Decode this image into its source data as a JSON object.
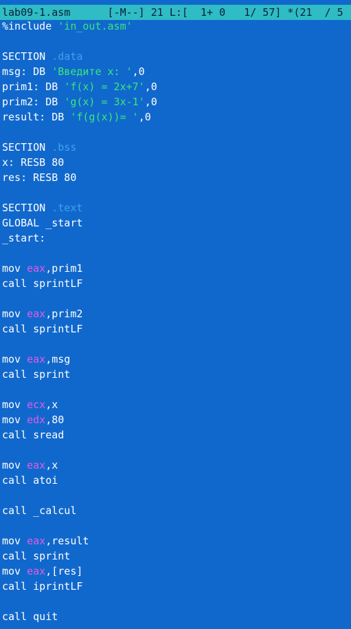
{
  "status": {
    "filename": "lab09-1.asm",
    "info": "      [-M--] 21 L:[  1+ 0   1/ 57] *(21  / 5"
  },
  "colors": {
    "background": "#1168cc",
    "status_bar": "#2fbcc4",
    "string": "#38e87a",
    "section_name": "#3fa2f0",
    "register": "#e05ce8",
    "text": "#ffffff"
  },
  "lines": [
    [
      {
        "t": "%include "
      },
      {
        "t": "'in_out.asm'",
        "c": "str"
      }
    ],
    [],
    [
      {
        "t": "SECTION "
      },
      {
        "t": ".data",
        "c": "sec"
      }
    ],
    [
      {
        "t": "msg: DB "
      },
      {
        "t": "'Введите x: '",
        "c": "str"
      },
      {
        "t": ",0"
      }
    ],
    [
      {
        "t": "prim1: DB "
      },
      {
        "t": "'f(x) = 2x+7'",
        "c": "str"
      },
      {
        "t": ",0"
      }
    ],
    [
      {
        "t": "prim2: DB "
      },
      {
        "t": "'g(x) = 3x-1'",
        "c": "str"
      },
      {
        "t": ",0"
      }
    ],
    [
      {
        "t": "result: DB "
      },
      {
        "t": "'f(g(x))= '",
        "c": "str"
      },
      {
        "t": ",0"
      }
    ],
    [],
    [
      {
        "t": "SECTION "
      },
      {
        "t": ".bss",
        "c": "sec"
      }
    ],
    [
      {
        "t": "x: RESB 80"
      }
    ],
    [
      {
        "t": "res: RESB 80"
      }
    ],
    [],
    [
      {
        "t": "SECTION "
      },
      {
        "t": ".text",
        "c": "sec"
      }
    ],
    [
      {
        "t": "GLOBAL _start"
      }
    ],
    [
      {
        "t": "_start:"
      }
    ],
    [],
    [
      {
        "t": "mov "
      },
      {
        "t": "eax",
        "c": "reg"
      },
      {
        "t": ",prim1"
      }
    ],
    [
      {
        "t": "call sprintLF"
      }
    ],
    [],
    [
      {
        "t": "mov "
      },
      {
        "t": "eax",
        "c": "reg"
      },
      {
        "t": ",prim2"
      }
    ],
    [
      {
        "t": "call sprintLF"
      }
    ],
    [],
    [
      {
        "t": "mov "
      },
      {
        "t": "eax",
        "c": "reg"
      },
      {
        "t": ",msg"
      }
    ],
    [
      {
        "t": "call sprint"
      }
    ],
    [],
    [
      {
        "t": "mov "
      },
      {
        "t": "ecx",
        "c": "reg"
      },
      {
        "t": ",x"
      }
    ],
    [
      {
        "t": "mov "
      },
      {
        "t": "edx",
        "c": "reg"
      },
      {
        "t": ",80"
      }
    ],
    [
      {
        "t": "call sread"
      }
    ],
    [],
    [
      {
        "t": "mov "
      },
      {
        "t": "eax",
        "c": "reg"
      },
      {
        "t": ",x"
      }
    ],
    [
      {
        "t": "call atoi"
      }
    ],
    [],
    [
      {
        "t": "call _calcul"
      }
    ],
    [],
    [
      {
        "t": "mov "
      },
      {
        "t": "eax",
        "c": "reg"
      },
      {
        "t": ",result"
      }
    ],
    [
      {
        "t": "call sprint"
      }
    ],
    [
      {
        "t": "mov "
      },
      {
        "t": "eax",
        "c": "reg"
      },
      {
        "t": ",[res]"
      }
    ],
    [
      {
        "t": "call iprintLF"
      }
    ],
    [],
    [
      {
        "t": "call quit"
      }
    ]
  ]
}
